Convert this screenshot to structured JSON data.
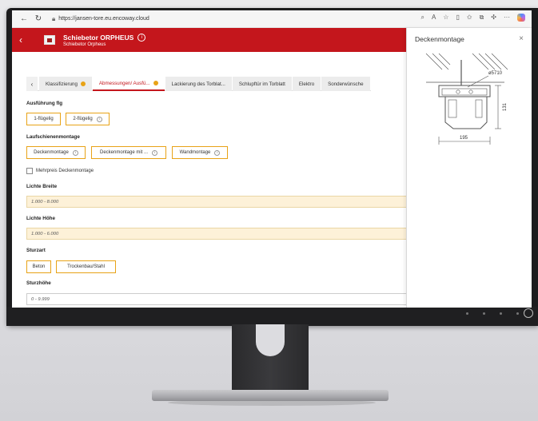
{
  "browser": {
    "url": "https://jansen-tore.eu.encoway.cloud"
  },
  "app": {
    "title": "Schiebetor ORPHEUS",
    "subtitle": "Schiebetor Orpheus"
  },
  "tabs": [
    {
      "label": "Klassifizierung",
      "badge": true
    },
    {
      "label": "Abmessungen/ Ausfü...",
      "badge": true,
      "active": true
    },
    {
      "label": "Lackierung des Torblat...",
      "badge": false
    },
    {
      "label": "Schlupftür im Torblatt",
      "badge": false
    },
    {
      "label": "Elektro",
      "badge": false
    },
    {
      "label": "Sonderwünsche",
      "badge": false
    }
  ],
  "form": {
    "ausfuehrung": {
      "label": "Ausführung flg",
      "options": [
        "1-flügelig",
        "2-flügelig"
      ]
    },
    "laufschiene": {
      "label": "Laufschienenmontage",
      "options": [
        "Deckenmontage",
        "Deckenmontage mit ...",
        "Wandmontage"
      ]
    },
    "mehrpreis": {
      "label": "Mehrpreis Deckenmontage"
    },
    "lichte_breite": {
      "label": "Lichte Breite",
      "placeholder": "1.000 - 8.000"
    },
    "lichte_hoehe": {
      "label": "Lichte Höhe",
      "placeholder": "1.000 - 6.000"
    },
    "sturzart": {
      "label": "Sturzart",
      "options": [
        "Beton",
        "Trockenbau/Stahl"
      ]
    },
    "sturzhoehe": {
      "label": "Sturzhöhe",
      "placeholder": "0 - 9.999"
    }
  },
  "panel": {
    "title": "Deckenmontage",
    "close": "×",
    "drawing": {
      "label_top": "ø5710",
      "dim_width": "195",
      "dim_height": "131"
    }
  },
  "colors": {
    "brand_red": "#c4161c",
    "accent_amber": "#e8a317",
    "input_fill": "#fdf1d8"
  },
  "icons": {
    "back": "chevron-left-icon",
    "reload": "reload-icon",
    "lock": "lock-icon",
    "info": "info-icon",
    "close": "close-icon"
  }
}
